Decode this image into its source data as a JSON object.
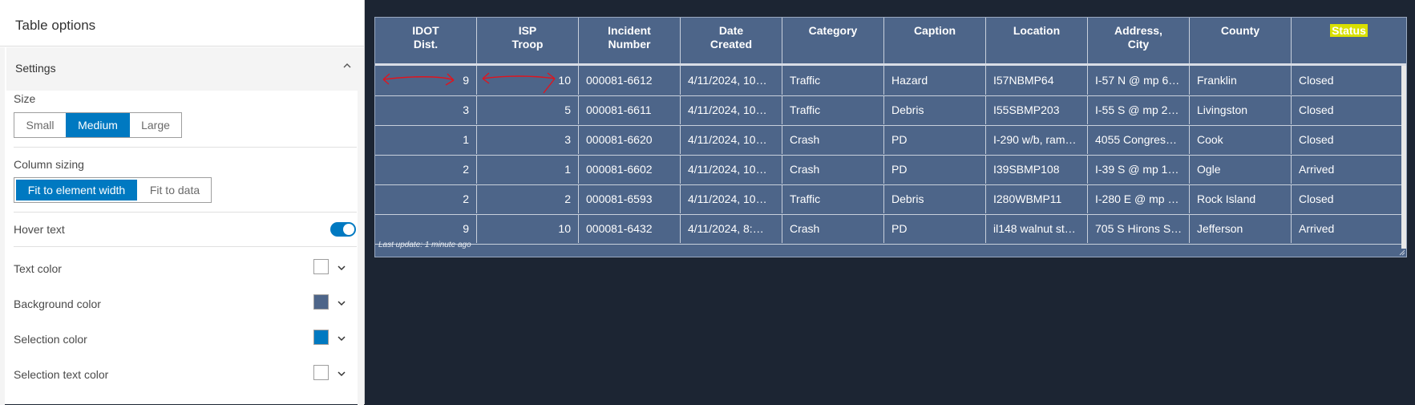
{
  "panel": {
    "title": "Table options",
    "section": "Settings",
    "size": {
      "label": "Size",
      "options": [
        "Small",
        "Medium",
        "Large"
      ],
      "selected": "Medium"
    },
    "column_sizing": {
      "label": "Column sizing",
      "options": [
        "Fit to element width",
        "Fit to data"
      ],
      "selected": "Fit to element width"
    },
    "hover_text": {
      "label": "Hover text",
      "enabled": true
    },
    "colors": [
      {
        "label": "Text color",
        "value": "#ffffff"
      },
      {
        "label": "Background color",
        "value": "#4d6589"
      },
      {
        "label": "Selection color",
        "value": "#0079c1"
      },
      {
        "label": "Selection text color",
        "value": "#ffffff"
      }
    ]
  },
  "table": {
    "headers": [
      [
        "IDOT",
        "Dist."
      ],
      [
        "ISP",
        "Troop"
      ],
      [
        "Incident",
        "Number"
      ],
      [
        "Date",
        "Created"
      ],
      [
        "Category"
      ],
      [
        "Caption"
      ],
      [
        "Location"
      ],
      [
        "Address,",
        "City"
      ],
      [
        "County"
      ],
      [
        "Status"
      ]
    ],
    "rows": [
      [
        "9",
        "10",
        "000081-6612",
        "4/11/2024, 10…",
        "Traffic",
        "Hazard",
        "I57NBMP64",
        "I-57 N @ mp 6…",
        "Franklin",
        "Closed"
      ],
      [
        "3",
        "5",
        "000081-6611",
        "4/11/2024, 10…",
        "Traffic",
        "Debris",
        "I55SBMP203",
        "I-55 S @ mp 2…",
        "Livingston",
        "Closed"
      ],
      [
        "1",
        "3",
        "000081-6620",
        "4/11/2024, 10…",
        "Crash",
        "PD",
        "I-290 w/b, ram…",
        "4055 Congres…",
        "Cook",
        "Closed"
      ],
      [
        "2",
        "1",
        "000081-6602",
        "4/11/2024, 10…",
        "Crash",
        "PD",
        "I39SBMP108",
        "I-39 S @ mp 1…",
        "Ogle",
        "Arrived"
      ],
      [
        "2",
        "2",
        "000081-6593",
        "4/11/2024, 10…",
        "Traffic",
        "Debris",
        "I280WBMP11",
        "I-280 E @ mp …",
        "Rock Island",
        "Closed"
      ],
      [
        "9",
        "10",
        "000081-6432",
        "4/11/2024, 8:…",
        "Crash",
        "PD",
        "il148 walnut st…",
        "705 S Hirons S…",
        "Jefferson",
        "Arrived"
      ]
    ],
    "footer": "Last update: 1 minute ago",
    "status_highlight_color": "#d9e000",
    "annotation_color": "#e0141e"
  }
}
